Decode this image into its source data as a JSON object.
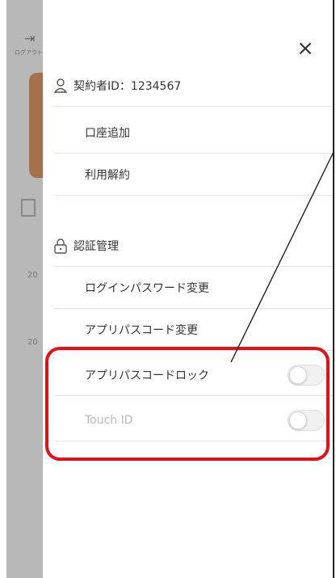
{
  "menu": {
    "close_label": "×",
    "contractor_label": "契約者ID：1234567",
    "account_add_label": "口座追加",
    "cancel_usage_label": "利用解約",
    "auth_section_label": "認証管理",
    "login_password_label": "ログインパスワード変更",
    "app_passcode_change_label": "アプリパスコード変更",
    "app_passcode_lock_label": "アプリパスコードロック",
    "touch_id_label": "Touch ID",
    "app_passcode_lock_on": false,
    "touch_id_on": false,
    "touch_id_enabled": false
  },
  "background": {
    "logout_label": "ログアウト",
    "years": [
      "20",
      "20",
      "20"
    ]
  },
  "colors": {
    "annotation_red": "#e3101a",
    "text": "#333333",
    "disabled_text": "#b9b9b9"
  }
}
